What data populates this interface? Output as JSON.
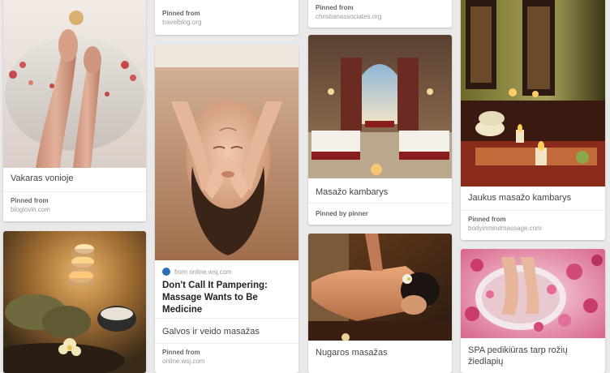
{
  "pins": {
    "col1": {
      "bath": {
        "description": "Vakaras vonioje",
        "attribution_title": "Pinned from",
        "attribution_source": "bloglovin.com",
        "image_label": "bath-with-rose-petals-image"
      },
      "candles": {
        "image_label": "candles-and-towels-image"
      }
    },
    "col2": {
      "top": {
        "attribution_title": "Pinned from",
        "attribution_source": "travelblog.org"
      },
      "facial": {
        "source_line": "from online.wsj.com",
        "headline": "Don't Call It Pampering: Massage Wants to Be Medicine",
        "description": "Galvos ir veido masažas",
        "attribution_title": "Pinned from",
        "attribution_source": "online.wsj.com",
        "image_label": "facial-massage-image"
      }
    },
    "col3": {
      "top": {
        "attribution_title": "Pinned from",
        "attribution_source": "christianassociates.org"
      },
      "room": {
        "description": "Masažo kambarys",
        "attribution_title": "Pinned by pinner",
        "image_label": "massage-room-image"
      },
      "back": {
        "description": "Nugaros masažas",
        "image_label": "back-massage-image"
      }
    },
    "col4": {
      "cozy": {
        "description": "Jaukus masažo kambarys",
        "attribution_title": "Pinned from",
        "attribution_source": "bodyinmindmassage.com",
        "image_label": "cozy-massage-room-image"
      },
      "pedicure": {
        "description": "SPA pedikiūras tarp rožių žiedlapių",
        "image_label": "pedicure-rose-petals-image"
      }
    }
  },
  "colors": {
    "background": "#e9e9e9",
    "card": "#ffffff",
    "source_icon": "#2b6fb6"
  }
}
